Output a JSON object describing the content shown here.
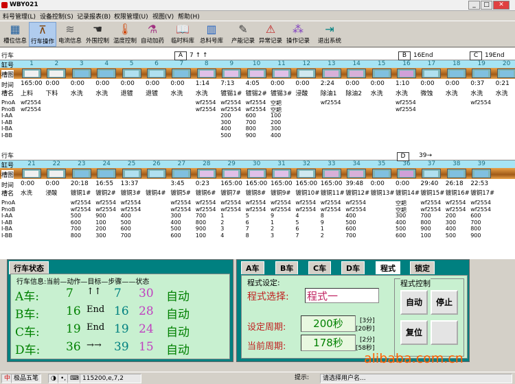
{
  "window": {
    "title": "WBY021"
  },
  "menu": [
    "料号管理(L)",
    "设备控制(S)",
    "记录报表(B)",
    "权限管理(U)",
    "视图(V)",
    "帮助(H)"
  ],
  "toolbar": [
    {
      "label": "槽位信息",
      "icon": "tank-icon"
    },
    {
      "label": "行车操作",
      "icon": "crane-icon"
    },
    {
      "label": "电流信息",
      "icon": "chart-icon"
    },
    {
      "label": "外围控制",
      "icon": "hand-icon"
    },
    {
      "label": "温度控制",
      "icon": "thermometer-icon"
    },
    {
      "label": "自动加药",
      "icon": "flask-icon"
    },
    {
      "label": "临时料库",
      "icon": "book-icon"
    },
    {
      "label": "总料号库",
      "icon": "books-icon"
    },
    {
      "label": "产能记录",
      "icon": "pen-icon"
    },
    {
      "label": "异常记录",
      "icon": "alert-icon"
    },
    {
      "label": "操作记录",
      "icon": "dots-icon"
    },
    {
      "label": "退出系统",
      "icon": "exit-icon"
    }
  ],
  "line1": {
    "label_crane": "行车",
    "label_slot": "缸号",
    "label_chart": "槽图",
    "label_time": "时间",
    "label_name": "槽名",
    "label_pno_a": "PnoA",
    "label_pno_b": "PnoB",
    "label_iaa": "I-AA",
    "label_iab": "I-AB",
    "label_iba": "I-BA",
    "label_ibb": "I-BB",
    "cranes": [
      {
        "id": "A",
        "text": "7 ↑ ↑"
      },
      {
        "id": "B",
        "text": "16End"
      },
      {
        "id": "C",
        "text": "19End"
      }
    ],
    "slots": [
      "1",
      "2",
      "3",
      "4",
      "5",
      "6",
      "7",
      "8",
      "9",
      "10",
      "11",
      "12",
      "13",
      "14",
      "15",
      "16",
      "17",
      "18",
      "19",
      "20"
    ],
    "times": [
      "165:00",
      "0:00",
      "0:00",
      "0:00",
      "0:00",
      "0:00",
      "0:00",
      "1:14",
      "7:13",
      "4:05",
      "0:00",
      "0:00",
      "2:24",
      "0:00",
      "0:00",
      "1:10",
      "0:00",
      "0:00",
      "0:37",
      "0:21"
    ],
    "names": [
      "上料",
      "下料",
      "水洗",
      "水洗",
      "退镀",
      "退镀",
      "水洗",
      "水洗",
      "镀锡1#",
      "镀锡2#",
      "镀锡3#",
      "浸酸",
      "除油1",
      "除油2",
      "水洗",
      "水洗",
      "微蚀",
      "水洗",
      "水洗",
      "水洗"
    ],
    "pno_a": {
      "0": "wf2554",
      "7": "wf2554",
      "8": "wf2554",
      "9": "wf2554",
      "10": "空耙",
      "12": "wf2554",
      "15": "wf2554",
      "18": "wf2554"
    },
    "pno_b": {
      "0": "wf2554",
      "7": "wf2554",
      "8": "wf2554",
      "9": "wf2554",
      "10": "空耙",
      "15": "wf2554"
    },
    "iaa": {
      "8": "200",
      "9": "600",
      "10": "100"
    },
    "iab": {
      "8": "300",
      "9": "700",
      "10": "200"
    },
    "iba": {
      "8": "400",
      "9": "800",
      "10": "300"
    },
    "ibb": {
      "8": "500",
      "9": "900",
      "10": "400"
    }
  },
  "line2": {
    "label_crane": "行车",
    "label_slot": "缸号",
    "label_chart": "槽图",
    "label_time": "时间",
    "label_name": "槽名",
    "label_pno_a": "PnoA",
    "label_pno_b": "PnoB",
    "label_iaa": "I-AA",
    "label_iab": "I-AB",
    "label_iba": "I-BA",
    "label_ibb": "I-BB",
    "cranes": [
      {
        "id": "D",
        "text": "39→"
      }
    ],
    "slots": [
      "21",
      "22",
      "23",
      "24",
      "25",
      "26",
      "27",
      "28",
      "29",
      "30",
      "31",
      "32",
      "33",
      "34",
      "35",
      "36",
      "37",
      "38",
      "39"
    ],
    "times": [
      "0:00",
      "0:00",
      "20:18",
      "16:55",
      "13:37",
      "",
      "3:45",
      "0:23",
      "165:00",
      "165:00",
      "165:00",
      "165:00",
      "165:00",
      "39:48",
      "0:00",
      "0:00",
      "29:40",
      "26:18",
      "22:53"
    ],
    "names": [
      "水洗",
      "浸酸",
      "镀铜1#",
      "镀铜2#",
      "镀铜3#",
      "镀铜4#",
      "镀铜5#",
      "镀铜6#",
      "镀铜7#",
      "镀铜8#",
      "镀铜9#",
      "镀铜10#",
      "镀铜11#",
      "镀铜12#",
      "镀铜13#",
      "镀铜14#",
      "镀铜15#",
      "镀铜16#",
      "镀铜17#"
    ],
    "pno_a": {
      "2": "wf2554",
      "3": "wf2554",
      "4": "wf2554",
      "6": "wf2554",
      "7": "wf2554",
      "8": "wf2554",
      "9": "wf2554",
      "10": "wf2554",
      "11": "wf2554",
      "12": "wf2554",
      "13": "wf2554",
      "15": "空耙",
      "16": "wf2554",
      "17": "wf2554",
      "18": "wf2554"
    },
    "pno_b": {
      "2": "wf2554",
      "3": "wf2554",
      "4": "wf2554",
      "6": "wf2554",
      "7": "wf2554",
      "8": "wf2554",
      "9": "wf2554",
      "10": "wf2554",
      "11": "wf2554",
      "12": "wf2554",
      "13": "wf2554",
      "15": "空耙",
      "16": "wf2554",
      "17": "wf2554",
      "18": "wf2554"
    },
    "iaa": {
      "2": "500",
      "3": "900",
      "4": "400",
      "6": "300",
      "7": "700",
      "8": "1",
      "9": "5",
      "10": "9",
      "11": "4",
      "12": "8",
      "13": "400",
      "15": "300",
      "16": "700",
      "17": "200",
      "18": "600"
    },
    "iab": {
      "2": "600",
      "3": "100",
      "4": "500",
      "6": "400",
      "7": "800",
      "8": "2",
      "9": "6",
      "10": "1",
      "11": "5",
      "12": "9",
      "13": "500",
      "15": "400",
      "16": "800",
      "17": "300",
      "18": "700"
    },
    "iba": {
      "2": "700",
      "3": "200",
      "4": "600",
      "6": "500",
      "7": "900",
      "8": "3",
      "9": "7",
      "10": "2",
      "11": "6",
      "12": "1",
      "13": "600",
      "15": "500",
      "16": "900",
      "17": "400",
      "18": "800"
    },
    "ibb": {
      "2": "800",
      "3": "300",
      "4": "700",
      "6": "600",
      "7": "100",
      "8": "4",
      "9": "8",
      "10": "3",
      "11": "7",
      "12": "2",
      "13": "700",
      "15": "600",
      "16": "100",
      "17": "500",
      "18": "900"
    }
  },
  "crane_status": {
    "tab": "行车状态",
    "header": "行车信息:当前—动作—目标—步骤——状态",
    "rows": [
      {
        "name": "A车:",
        "current": "7",
        "action": "↑↑",
        "target": "7",
        "step": "30",
        "state": "自动"
      },
      {
        "name": "B车:",
        "current": "16",
        "action": "End",
        "target": "16",
        "step": "28",
        "state": "自动"
      },
      {
        "name": "C车:",
        "current": "19",
        "action": "End",
        "target": "19",
        "step": "24",
        "state": "自动"
      },
      {
        "name": "D车:",
        "current": "36",
        "action": "→→",
        "target": "39",
        "step": "15",
        "state": "自动"
      }
    ]
  },
  "program": {
    "tabs": [
      "A车",
      "B车",
      "C车",
      "D车",
      "程式",
      "锁定"
    ],
    "settings_label": "程式设定:",
    "select_label": "程式选择:",
    "select_value": "程式一",
    "set_period_label": "设定周期:",
    "set_period_value": "200秒",
    "set_period_min": "[3分]",
    "set_period_sec": "[20秒]",
    "cur_period_label": "当前周期:",
    "cur_period_value": "178秒",
    "cur_period_min": "[2分]",
    "cur_period_sec": "[58秒]",
    "control_label": "程式控制",
    "btn_auto": "自动",
    "btn_stop": "停止",
    "btn_reset": "复位"
  },
  "watermark": "alibaba.com.cn",
  "taskbar": {
    "ime": "极品五笔",
    "coords": "115200,e,7,2",
    "hint_label": "提示:",
    "hint_text": "请选择用户名..."
  }
}
